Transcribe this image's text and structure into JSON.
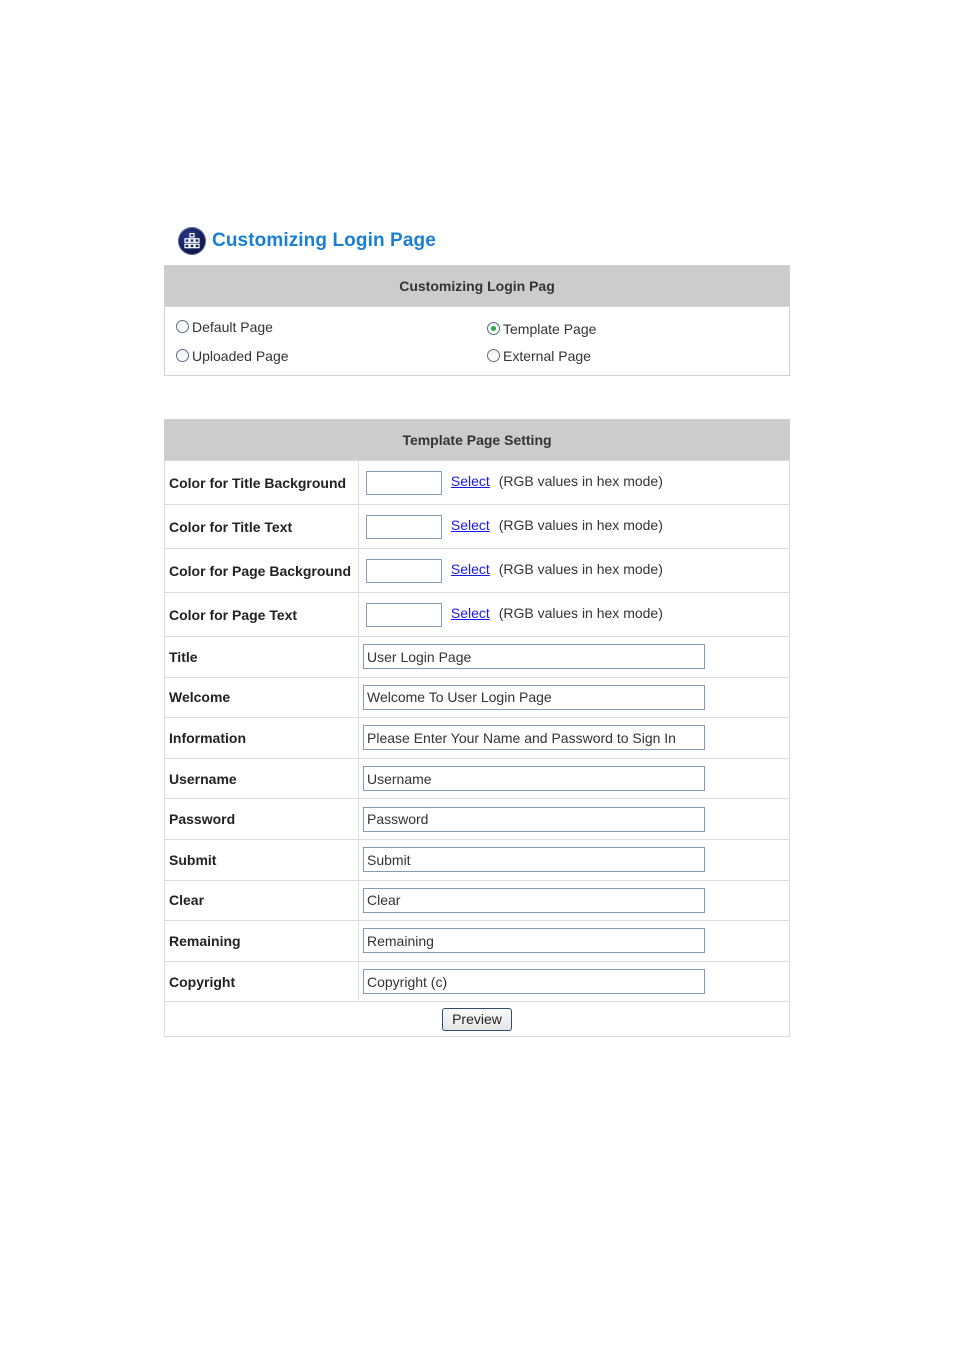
{
  "page": {
    "heading": "Customizing Login Page",
    "heading_icon": "grid-icon"
  },
  "login_page_type": {
    "header": "Customizing Login Pag",
    "options": [
      {
        "label": "Default Page",
        "selected": false
      },
      {
        "label": "Template Page",
        "selected": true
      },
      {
        "label": "Uploaded Page",
        "selected": false
      },
      {
        "label": "External Page",
        "selected": false
      }
    ]
  },
  "template_setting": {
    "header": "Template Page Setting",
    "color_rows": [
      {
        "label": "Color for Title Background",
        "value": "",
        "link": "Select",
        "hint": "(RGB values in hex mode)"
      },
      {
        "label": "Color for Title Text",
        "value": "",
        "link": "Select",
        "hint": "(RGB values in hex mode)"
      },
      {
        "label": "Color for Page Background",
        "value": "",
        "link": "Select",
        "hint": "(RGB values in hex mode)"
      },
      {
        "label": "Color for Page Text",
        "value": "",
        "link": "Select",
        "hint": "(RGB values in hex mode)"
      }
    ],
    "text_rows": [
      {
        "label": "Title",
        "value": "User Login Page"
      },
      {
        "label": "Welcome",
        "value": "Welcome To User Login Page"
      },
      {
        "label": "Information",
        "value": "Please Enter Your Name and Password to Sign In"
      },
      {
        "label": "Username",
        "value": "Username"
      },
      {
        "label": "Password",
        "value": "Password"
      },
      {
        "label": "Submit",
        "value": "Submit"
      },
      {
        "label": "Clear",
        "value": "Clear"
      },
      {
        "label": "Remaining",
        "value": "Remaining"
      },
      {
        "label": "Copyright",
        "value": "Copyright (c)"
      }
    ],
    "preview_button": "Preview"
  },
  "colors": {
    "heading": "#1a7fd4",
    "table_header_bg": "#cccccc",
    "link": "#1a1ae6",
    "radio_selected": "#2fa84a"
  }
}
